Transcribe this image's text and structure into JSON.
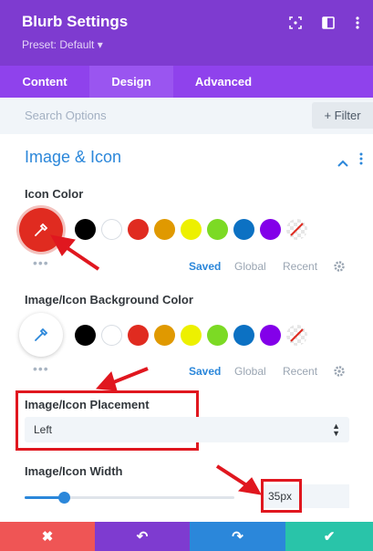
{
  "header": {
    "title": "Blurb Settings",
    "preset": "Preset: Default ▾",
    "icons": [
      "fullscreen-icon",
      "sidebar-toggle-icon",
      "more-menu-icon"
    ],
    "bg_color": "#7e3bd0"
  },
  "tabs": [
    {
      "label": "Content",
      "active": false
    },
    {
      "label": "Design",
      "active": true
    },
    {
      "label": "Advanced",
      "active": false
    }
  ],
  "search": {
    "placeholder": "Search Options",
    "filter_label": "+ Filter"
  },
  "section": {
    "title": "Image & Icon",
    "expanded": true,
    "accent": "#2b87da"
  },
  "icon_color": {
    "label": "Icon Color",
    "selected": "#e02b20",
    "palette": [
      "#000000",
      "#ffffff",
      "#e02b20",
      "#e09900",
      "#edf000",
      "#7cda24",
      "#0c71c3",
      "#8300e9",
      "none"
    ],
    "tabs": [
      "Saved",
      "Global",
      "Recent"
    ]
  },
  "bg_color": {
    "label": "Image/Icon Background Color",
    "selected": "none",
    "palette": [
      "#000000",
      "#ffffff",
      "#e02b20",
      "#e09900",
      "#edf000",
      "#7cda24",
      "#0c71c3",
      "#8300e9",
      "none"
    ],
    "tabs": [
      "Saved",
      "Global",
      "Recent"
    ]
  },
  "placement": {
    "label": "Image/Icon Placement",
    "value": "Left"
  },
  "width": {
    "label": "Image/Icon Width",
    "value": "35px",
    "slider_percent": 19
  },
  "footer": {
    "buttons": [
      {
        "name": "discard",
        "glyph": "✖",
        "color": "#ef5555"
      },
      {
        "name": "undo",
        "glyph": "↶",
        "color": "#7e3bd0"
      },
      {
        "name": "redo",
        "glyph": "↷",
        "color": "#2b87da"
      },
      {
        "name": "save",
        "glyph": "✔",
        "color": "#29c4a9"
      }
    ]
  },
  "annotation_color": "#e0171f"
}
